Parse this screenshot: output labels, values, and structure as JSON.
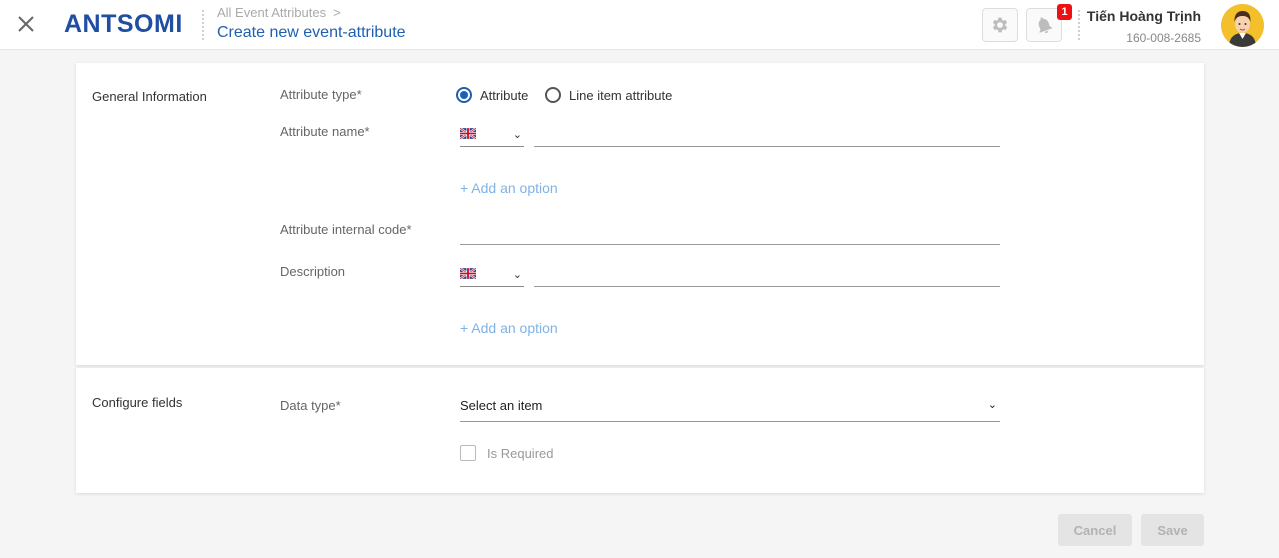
{
  "header": {
    "logo_text": "ANTSOMI",
    "breadcrumb_parent": "All Event Attributes",
    "breadcrumb_separator": ">",
    "page_title": "Create new event-attribute",
    "notification_count": "1",
    "user_name": "Tiến Hoàng Trịnh",
    "user_phone": "160-008-2685",
    "icons": [
      "close-icon",
      "gear-icon",
      "bell-icon"
    ],
    "accent_color": "#1f5fb0"
  },
  "general": {
    "section_title": "General Information",
    "attribute_type_label": "Attribute type*",
    "radio_options": [
      {
        "label": "Attribute",
        "selected": true
      },
      {
        "label": "Line item attribute",
        "selected": false
      }
    ],
    "attribute_name_label": "Attribute name*",
    "attribute_name_value": "",
    "add_option_1": "+ Add an option",
    "internal_code_label": "Attribute internal code*",
    "internal_code_value": "",
    "description_label": "Description",
    "description_value": "",
    "add_option_2": "+ Add an option"
  },
  "configure": {
    "section_title": "Configure fields",
    "data_type_label": "Data type*",
    "data_type_selected": "Select an item",
    "is_required_label": "Is Required",
    "is_required_checked": false
  },
  "footer": {
    "cancel_label": "Cancel",
    "save_label": "Save"
  }
}
